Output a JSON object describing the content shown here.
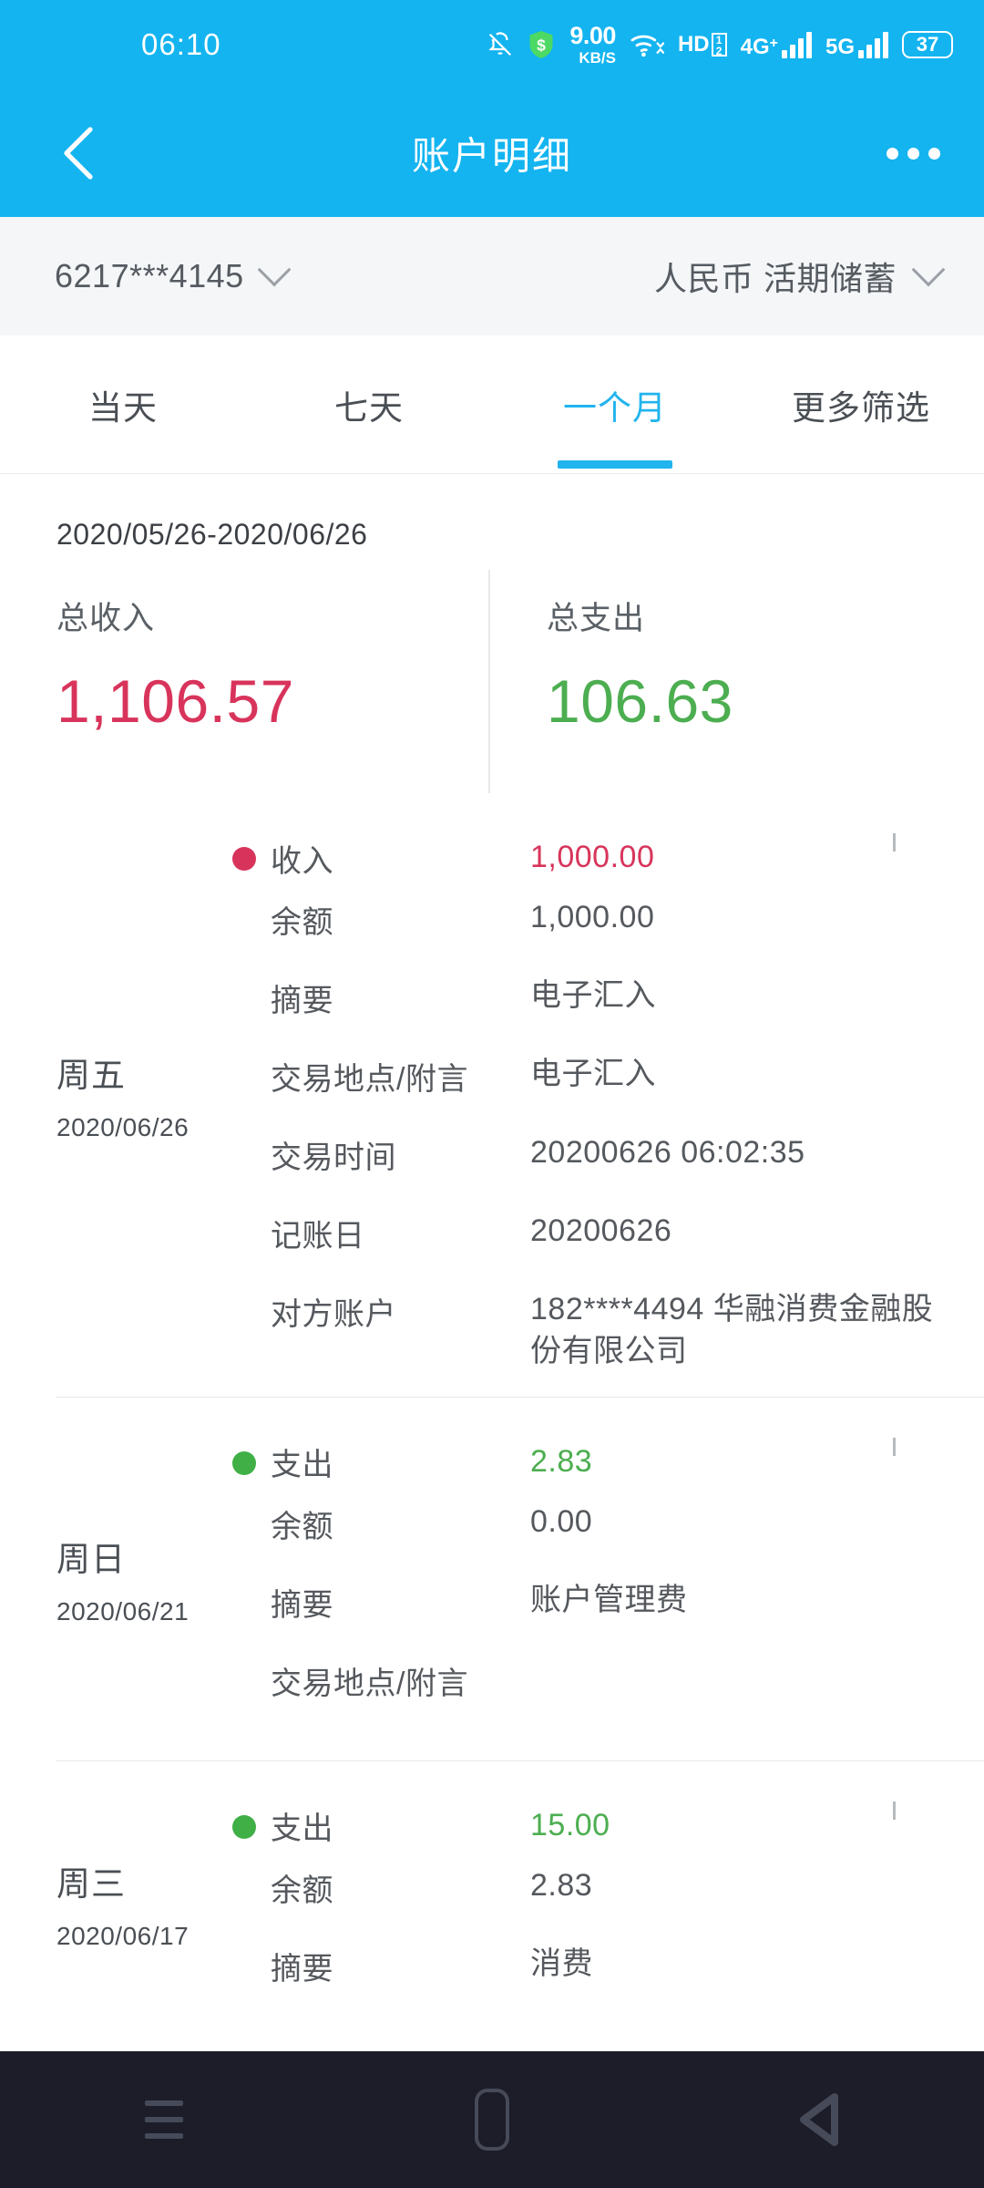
{
  "status_bar": {
    "time": "06:10",
    "icons": [
      "bell-muted-icon",
      "security-shield-icon",
      "wifi-icon",
      "hd-voice-icon",
      "signal-4g-icon",
      "signal-5g-icon",
      "battery-icon"
    ],
    "net_speed_value": "9.00",
    "net_speed_unit": "KB/S",
    "hd_label": "HD",
    "hd_sim_top": "1",
    "hd_sim_bottom": "2",
    "g4_label": "4G",
    "g4_sup": "+",
    "g5_label": "5G",
    "battery_level": "37"
  },
  "header": {
    "title": "账户明细",
    "back_icon": "chevron-left-icon",
    "more_icon": "more-horizontal-icon"
  },
  "account_bar": {
    "card_number": "6217***4145",
    "account_type": "人民币 活期储蓄"
  },
  "tabs": [
    {
      "label": "当天",
      "active": false
    },
    {
      "label": "七天",
      "active": false
    },
    {
      "label": "一个月",
      "active": true
    },
    {
      "label": "更多筛选",
      "active": false
    }
  ],
  "summary": {
    "date_range": "2020/05/26-2020/06/26",
    "income_label": "总收入",
    "income_value": "1,106.57",
    "income_color": "#D8345B",
    "expense_label": "总支出",
    "expense_value": "106.63",
    "expense_color": "#4CAE50"
  },
  "transactions": [
    {
      "weekday": "周五",
      "date": "2020/06/26",
      "type_label": "收入",
      "kind": "income",
      "amount": "1,000.00",
      "expanded": true,
      "chevron": "chevron-up-icon",
      "details": [
        {
          "label": "余额",
          "value": "1,000.00"
        },
        {
          "label": "摘要",
          "value": "电子汇入"
        },
        {
          "label": "交易地点/附言",
          "value": "电子汇入"
        },
        {
          "label": "交易时间",
          "value": "20200626 06:02:35"
        },
        {
          "label": "记账日",
          "value": "20200626"
        },
        {
          "label": "对方账户",
          "value": "182****4494 华融消费金融股份有限公司"
        }
      ]
    },
    {
      "weekday": "周日",
      "date": "2020/06/21",
      "type_label": "支出",
      "kind": "expense",
      "amount": "2.83",
      "expanded": false,
      "chevron": "chevron-down-icon",
      "details": [
        {
          "label": "余额",
          "value": "0.00"
        },
        {
          "label": "摘要",
          "value": "账户管理费"
        },
        {
          "label": "交易地点/附言",
          "value": ""
        }
      ]
    },
    {
      "weekday": "周三",
      "date": "2020/06/17",
      "type_label": "支出",
      "kind": "expense",
      "amount": "15.00",
      "expanded": false,
      "chevron": "chevron-down-icon",
      "details": [
        {
          "label": "余额",
          "value": "2.83"
        },
        {
          "label": "摘要",
          "value": "消费"
        }
      ]
    }
  ],
  "nav_bar": {
    "recents_icon": "recents-icon",
    "home_icon": "home-icon",
    "back_icon": "back-triangle-icon"
  }
}
